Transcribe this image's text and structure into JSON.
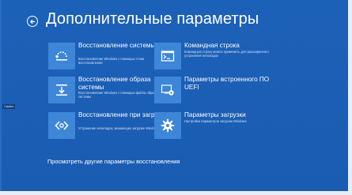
{
  "header": {
    "title": "Дополнительные параметры"
  },
  "side_label": "Caption",
  "tiles": [
    {
      "title": "Восстановление системы",
      "description": "Восстановление Windows с помощью точки восстановления",
      "icon": "system-restore-icon"
    },
    {
      "title": "Командная строка",
      "description": "Командную строку можно применить для расширенного устранения неполадок",
      "icon": "command-prompt-icon"
    },
    {
      "title": "Восстановление образа системы",
      "description": "Восстановление Windows с помощью файла образа системы",
      "icon": "system-image-icon"
    },
    {
      "title": "Параметры встроенного ПО UEFI",
      "description": "",
      "icon": "uefi-settings-icon"
    },
    {
      "title": "Восстановление при загрузке",
      "description": "Устранение неполадок, мешающих загрузке Windows",
      "icon": "startup-repair-icon"
    },
    {
      "title": "Параметры загрузки",
      "description": "Настройка параметров загрузки Windows",
      "icon": "gear-icon"
    }
  ],
  "footer": {
    "more_link": "Просмотреть другие параметры восстановления"
  },
  "colors": {
    "background": "#1b5fb6",
    "tile_icon": "#3d86d8"
  }
}
